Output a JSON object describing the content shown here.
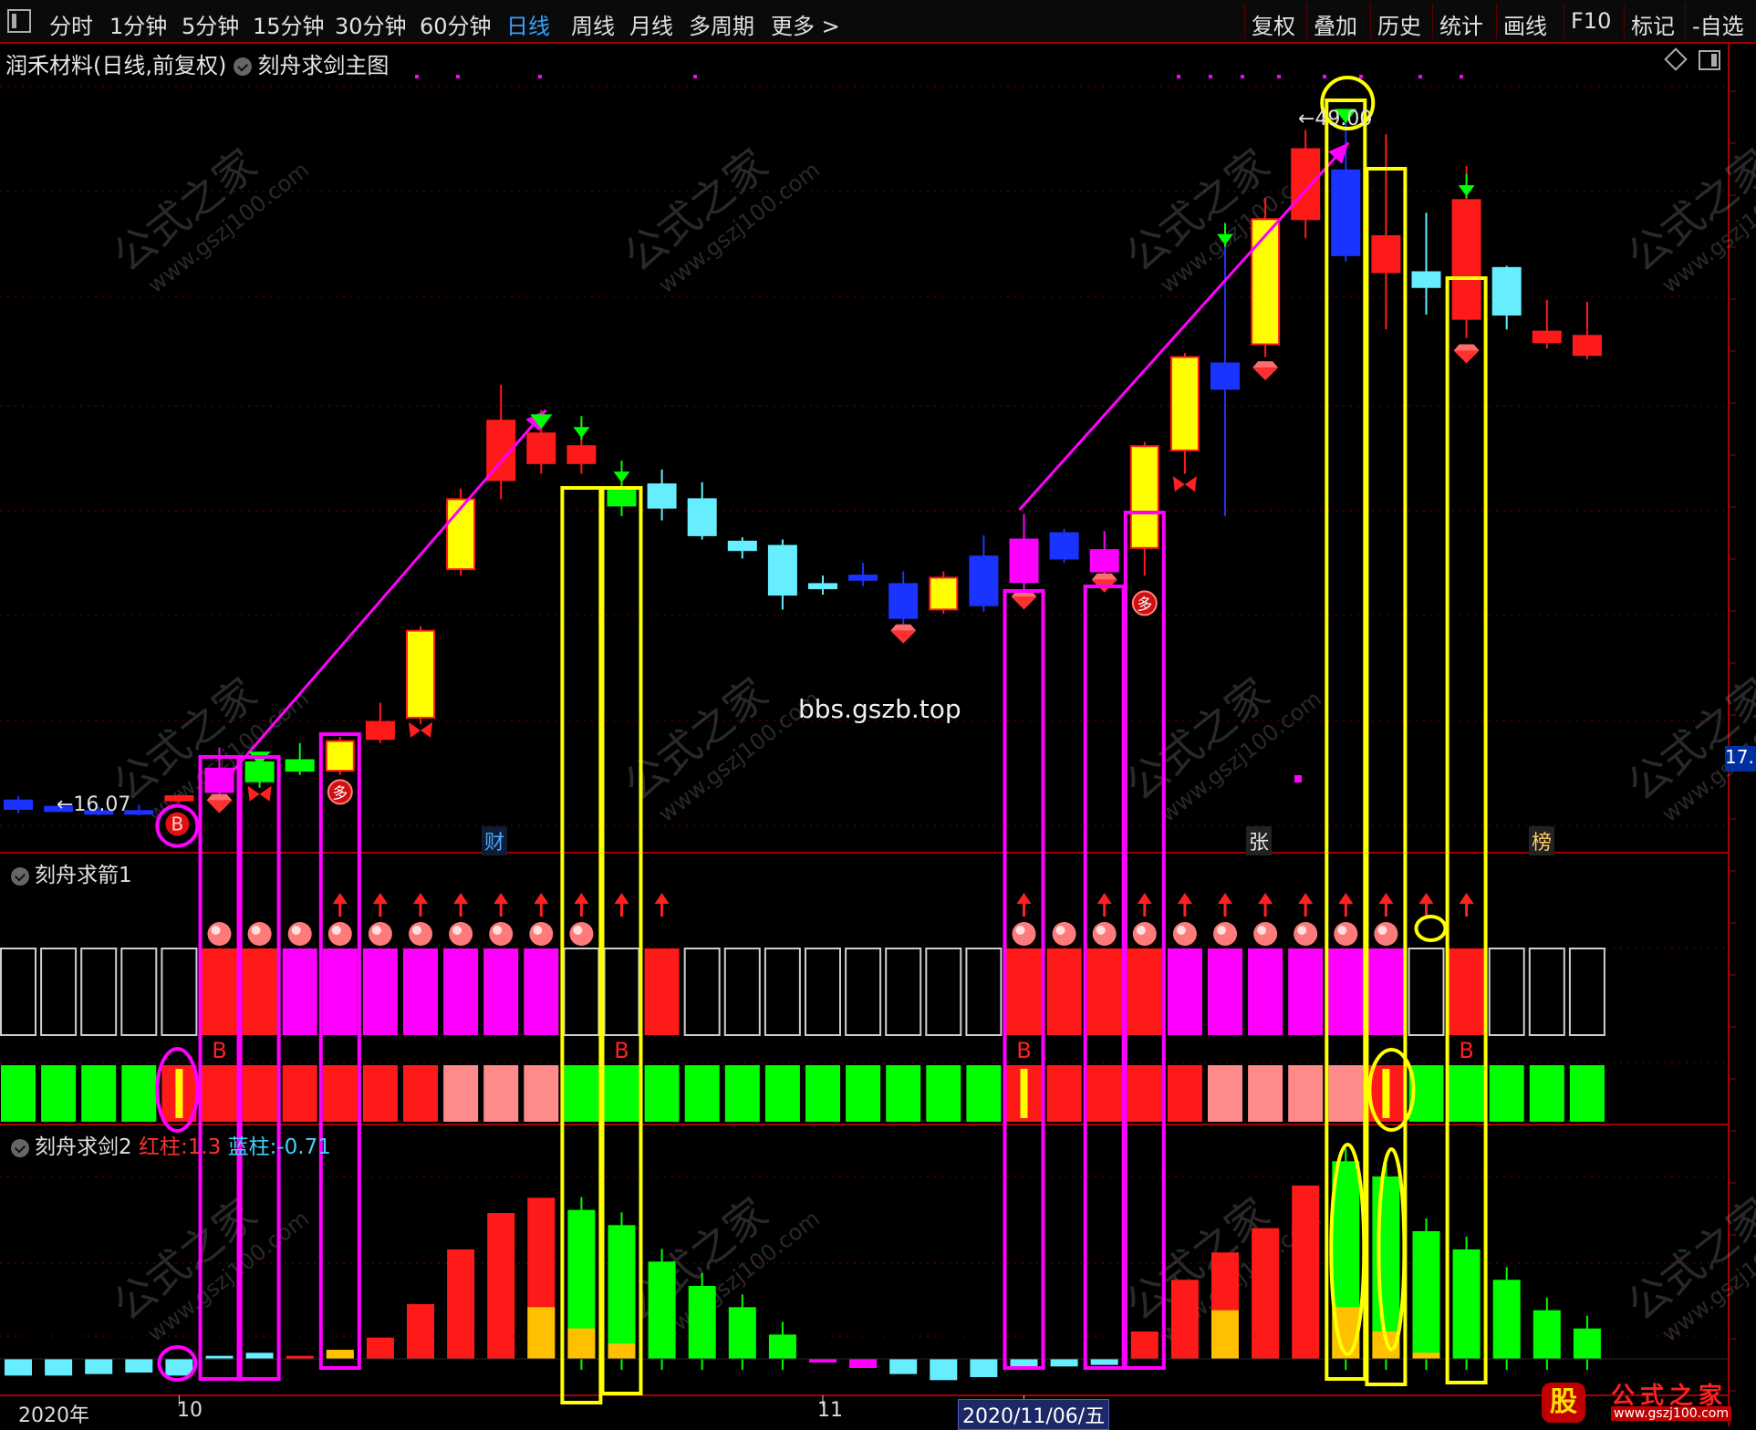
{
  "toolbar": {
    "left_items": [
      "分时",
      "1分钟",
      "5分钟",
      "15分钟",
      "30分钟",
      "60分钟",
      "日线",
      "周线",
      "月线",
      "多周期",
      "更多 >"
    ],
    "active_item": "日线",
    "right_items": [
      "复权",
      "叠加",
      "历史",
      "统计",
      "画线",
      "F10",
      "标记",
      "-自选"
    ]
  },
  "main_panel": {
    "title": "润禾材料(日线,前复权)",
    "formula": "刻舟求剑主图",
    "price_low_label": "←16.07",
    "price_high_label": "←49.00",
    "site_text": "bbs.gszb.top",
    "right_price_tag": "17.",
    "badges": {
      "cai": "财",
      "zhang": "张",
      "bang": "榜"
    }
  },
  "arrow_panel": {
    "title": "刻舟求箭1"
  },
  "sword_panel": {
    "title": "刻舟求剑2",
    "red_label": "红柱:",
    "red_value": "1.3",
    "blue_label": "蓝柱:",
    "blue_value": "-0.71"
  },
  "x_axis": {
    "labels": [
      "2020年",
      "10",
      "11"
    ],
    "current_date": "2020/11/06/五"
  },
  "markers": {
    "b": "B",
    "duo": "多"
  },
  "watermark": {
    "text": "公式之家",
    "url": "www.gszj100.com"
  },
  "brand": {
    "icon_char": "股",
    "name": "公式之家",
    "url": "www.gszj100.com"
  },
  "colors": {
    "up": "#ff1a1a",
    "down_blue": "#1a33ff",
    "cyan": "#66eeff",
    "yellow": "#ffff00",
    "magenta": "#ff00ff",
    "green": "#00ff00",
    "pink": "#ff8a8a",
    "orange": "#ffc000",
    "grid": "#7a0000"
  },
  "chart_data": {
    "type": "candlestick",
    "title": "润禾材料(日线,前复权)",
    "dates_shown": [
      "2020年",
      "10",
      "11",
      "2020/11/06/五"
    ],
    "price_min": 16.07,
    "price_max": 49.0,
    "candles": [
      {
        "o": 16.2,
        "c": 16.6,
        "h": 16.8,
        "l": 16.0,
        "color": "blue"
      },
      {
        "o": 16.3,
        "c": 16.1,
        "h": 16.5,
        "l": 16.07,
        "color": "blue"
      },
      {
        "o": 16.1,
        "c": 16.0,
        "h": 16.3,
        "l": 15.9,
        "color": "blue"
      },
      {
        "o": 16.0,
        "c": 16.1,
        "h": 16.4,
        "l": 15.9,
        "color": "blue"
      },
      {
        "o": 16.6,
        "c": 16.8,
        "h": 16.9,
        "l": 16.5,
        "color": "red"
      },
      {
        "o": 17.0,
        "c": 18.1,
        "h": 19.1,
        "l": 16.5,
        "color": "magenta"
      },
      {
        "o": 17.5,
        "c": 18.4,
        "h": 18.8,
        "l": 17.2,
        "color": "green"
      },
      {
        "o": 18.5,
        "c": 18.0,
        "h": 19.3,
        "l": 17.8,
        "color": "green"
      },
      {
        "o": 18.0,
        "c": 19.4,
        "h": 19.6,
        "l": 17.8,
        "color": "yellow"
      },
      {
        "o": 19.5,
        "c": 20.3,
        "h": 21.2,
        "l": 19.3,
        "color": "red"
      },
      {
        "o": 20.5,
        "c": 24.6,
        "h": 24.8,
        "l": 20.2,
        "color": "yellow"
      },
      {
        "o": 27.5,
        "c": 30.8,
        "h": 31.3,
        "l": 27.2,
        "color": "yellow"
      },
      {
        "o": 31.7,
        "c": 34.5,
        "h": 36.2,
        "l": 30.8,
        "color": "red"
      },
      {
        "o": 32.5,
        "c": 33.9,
        "h": 35.0,
        "l": 32.0,
        "color": "red"
      },
      {
        "o": 33.3,
        "c": 32.5,
        "h": 34.5,
        "l": 32.0,
        "color": "red"
      },
      {
        "o": 31.2,
        "c": 30.5,
        "h": 32.0,
        "l": 30.0,
        "color": "green"
      },
      {
        "o": 31.5,
        "c": 30.4,
        "h": 32.2,
        "l": 29.8,
        "color": "cyan"
      },
      {
        "o": 30.8,
        "c": 29.1,
        "h": 31.6,
        "l": 28.9,
        "color": "cyan"
      },
      {
        "o": 28.8,
        "c": 28.4,
        "h": 29.0,
        "l": 28.0,
        "color": "cyan"
      },
      {
        "o": 28.6,
        "c": 26.3,
        "h": 28.9,
        "l": 25.6,
        "color": "cyan"
      },
      {
        "o": 26.8,
        "c": 26.6,
        "h": 27.2,
        "l": 26.3,
        "color": "cyan"
      },
      {
        "o": 27.2,
        "c": 27.0,
        "h": 27.8,
        "l": 26.7,
        "color": "blue"
      },
      {
        "o": 26.8,
        "c": 25.2,
        "h": 27.4,
        "l": 24.9,
        "color": "blue"
      },
      {
        "o": 25.6,
        "c": 27.1,
        "h": 27.4,
        "l": 25.4,
        "color": "yellow"
      },
      {
        "o": 25.8,
        "c": 28.1,
        "h": 29.1,
        "l": 25.5,
        "color": "blue"
      },
      {
        "o": 28.9,
        "c": 26.9,
        "h": 30.1,
        "l": 26.5,
        "color": "magenta"
      },
      {
        "o": 28.0,
        "c": 29.2,
        "h": 29.4,
        "l": 27.8,
        "color": "blue"
      },
      {
        "o": 27.4,
        "c": 28.4,
        "h": 29.3,
        "l": 27.0,
        "color": "magenta"
      },
      {
        "o": 28.5,
        "c": 33.3,
        "h": 33.5,
        "l": 27.2,
        "color": "yellow"
      },
      {
        "o": 33.1,
        "c": 37.5,
        "h": 37.7,
        "l": 32.0,
        "color": "yellow"
      },
      {
        "o": 36.0,
        "c": 37.2,
        "h": 43.0,
        "l": 30.0,
        "color": "blue"
      },
      {
        "o": 38.1,
        "c": 44.0,
        "h": 45.0,
        "l": 37.5,
        "color": "yellow"
      },
      {
        "o": 44.0,
        "c": 47.3,
        "h": 48.2,
        "l": 43.1,
        "color": "red"
      },
      {
        "o": 46.3,
        "c": 42.3,
        "h": 49.0,
        "l": 42.0,
        "color": "blue"
      },
      {
        "o": 43.2,
        "c": 41.5,
        "h": 48.0,
        "l": 38.8,
        "color": "red"
      },
      {
        "o": 41.5,
        "c": 40.8,
        "h": 44.3,
        "l": 39.5,
        "color": "cyan"
      },
      {
        "o": 39.3,
        "c": 44.9,
        "h": 46.5,
        "l": 38.4,
        "color": "red"
      },
      {
        "o": 41.7,
        "c": 39.5,
        "h": 41.8,
        "l": 38.8,
        "color": "cyan"
      },
      {
        "o": 38.7,
        "c": 38.2,
        "h": 40.2,
        "l": 37.9,
        "color": "red"
      },
      {
        "o": 38.5,
        "c": 37.6,
        "h": 40.1,
        "l": 37.4,
        "color": "red"
      }
    ],
    "arrow_panel": {
      "top_row": [
        "empty",
        "empty",
        "empty",
        "empty",
        "empty",
        "red",
        "red",
        "magenta",
        "magenta",
        "magenta",
        "magenta",
        "magenta",
        "magenta",
        "magenta",
        "empty",
        "empty",
        "red",
        "empty",
        "empty",
        "empty",
        "empty",
        "empty",
        "empty",
        "empty",
        "empty",
        "red",
        "red",
        "red",
        "red",
        "magenta",
        "magenta",
        "magenta",
        "magenta",
        "magenta",
        "magenta",
        "empty",
        "red",
        "empty",
        "empty",
        "empty"
      ],
      "bottom_row": [
        "green",
        "green",
        "green",
        "green",
        "yellow",
        "red",
        "red",
        "red",
        "red",
        "red",
        "red",
        "pink",
        "pink",
        "pink",
        "green",
        "green",
        "green",
        "green",
        "green",
        "green",
        "green",
        "green",
        "green",
        "green",
        "green",
        "yellow",
        "red",
        "red",
        "red",
        "red",
        "pink",
        "pink",
        "pink",
        "pink",
        "yellow",
        "green",
        "green",
        "green",
        "green",
        "green"
      ],
      "balls": [
        5,
        6,
        7,
        8,
        9,
        10,
        11,
        12,
        13,
        14,
        25,
        26,
        27,
        28,
        29,
        30,
        31,
        32,
        33,
        34
      ],
      "up_arrows": [
        8,
        9,
        10,
        11,
        12,
        13,
        14,
        15,
        16,
        25,
        27,
        28,
        29,
        30,
        31,
        32,
        33,
        34,
        35,
        36
      ],
      "b_markers": [
        5,
        15,
        25,
        36
      ]
    },
    "sword_panel": {
      "values": [
        -0.55,
        -0.55,
        -0.5,
        -0.45,
        -0.55,
        0.1,
        0.2,
        0.1,
        0.3,
        0.7,
        1.8,
        3.6,
        4.8,
        5.3,
        4.9,
        4.4,
        3.2,
        2.4,
        1.7,
        0.8,
        0.0,
        -0.3,
        -0.5,
        -0.7,
        -0.6,
        -0.3,
        -0.25,
        -0.2,
        0.9,
        2.6,
        3.5,
        4.3,
        5.7,
        6.5,
        6.0,
        4.2,
        3.6,
        2.6,
        1.6,
        1.0
      ],
      "colors": [
        "cyan",
        "cyan",
        "cyan",
        "cyan",
        "cyan",
        "cyan",
        "cyan",
        "red",
        "orange",
        "red",
        "red",
        "red",
        "red",
        "red",
        "green",
        "green",
        "green",
        "green",
        "green",
        "green",
        "magenta",
        "magenta",
        "cyan",
        "cyan",
        "cyan",
        "cyan",
        "cyan",
        "cyan",
        "red",
        "red",
        "red",
        "red",
        "red",
        "green",
        "green",
        "green",
        "green",
        "green",
        "green",
        "green"
      ],
      "yellow_part": [
        0,
        0,
        0,
        0,
        0,
        0,
        0,
        0,
        0.2,
        0,
        0,
        0,
        0,
        1.7,
        1.0,
        0.5,
        0,
        0,
        0,
        0,
        0,
        0,
        0,
        0,
        0,
        0,
        0,
        0,
        0,
        0,
        1.6,
        0,
        0,
        1.7,
        0.9,
        0.2,
        0,
        0,
        0,
        0
      ]
    }
  }
}
